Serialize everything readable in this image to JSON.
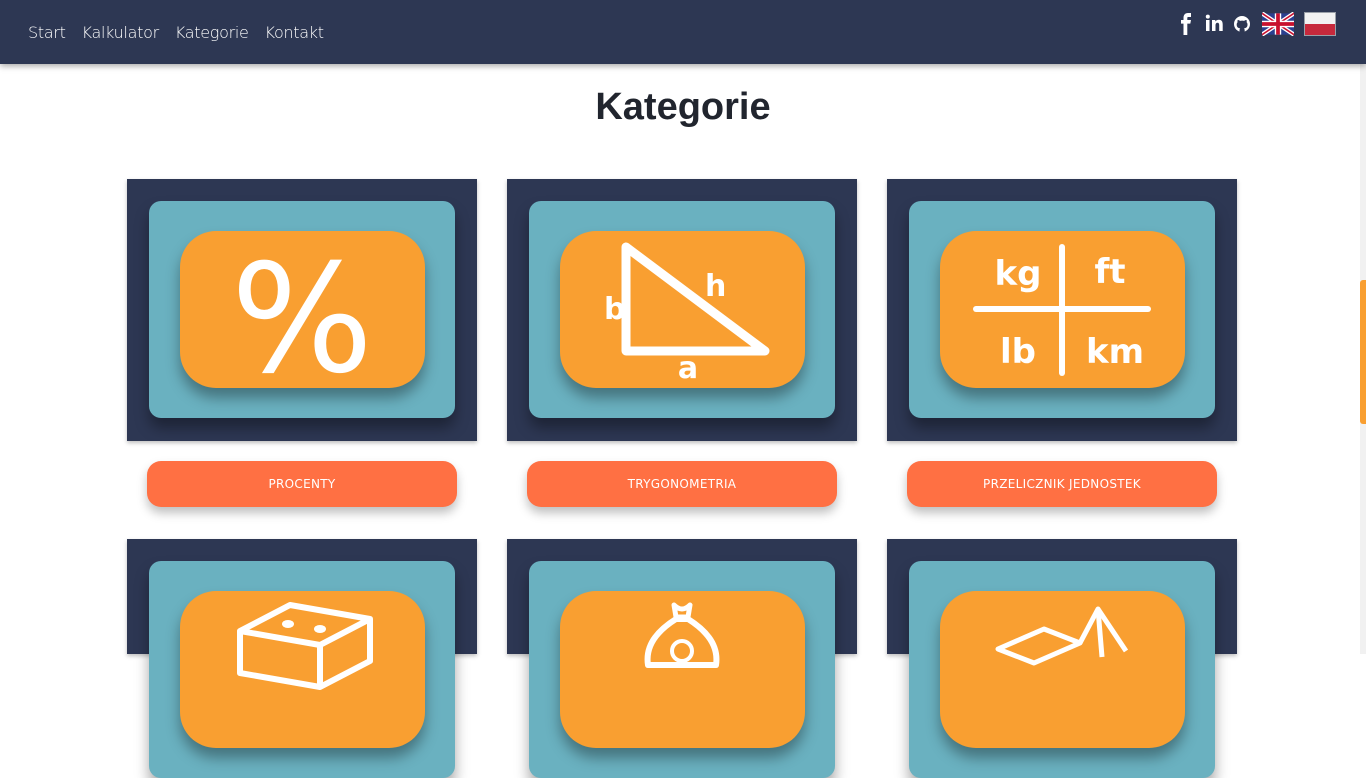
{
  "nav": {
    "links": [
      "Start",
      "Kalkulator",
      "Kategorie",
      "Kontakt"
    ]
  },
  "social": [
    "facebook-icon",
    "linkedin-icon",
    "github-icon"
  ],
  "languages": [
    "english-flag",
    "polish-flag"
  ],
  "page": {
    "title": "Kategorie"
  },
  "categories": [
    {
      "label": "PROCENTY",
      "icon": "percent-icon"
    },
    {
      "label": "TRYGONOMETRIA",
      "icon": "triangle-icon"
    },
    {
      "label": "PRZELICZNIK JEDNOSTEK",
      "icon": "units-icon"
    },
    {
      "label": "",
      "icon": "dice-icon"
    },
    {
      "label": "",
      "icon": "money-bag-icon"
    },
    {
      "label": "",
      "icon": "geometry-shapes-icon"
    }
  ],
  "icon_text": {
    "percent": "%",
    "tri_b": "b",
    "tri_h": "h",
    "tri_a": "a",
    "unit_kg": "kg",
    "unit_ft": "ft",
    "unit_lb": "lb",
    "unit_km": "km"
  },
  "colors": {
    "navbar": "#2d3753",
    "card_inner": "#6ab1c0",
    "icon_bg": "#f99f31",
    "button": "#ff7043"
  }
}
